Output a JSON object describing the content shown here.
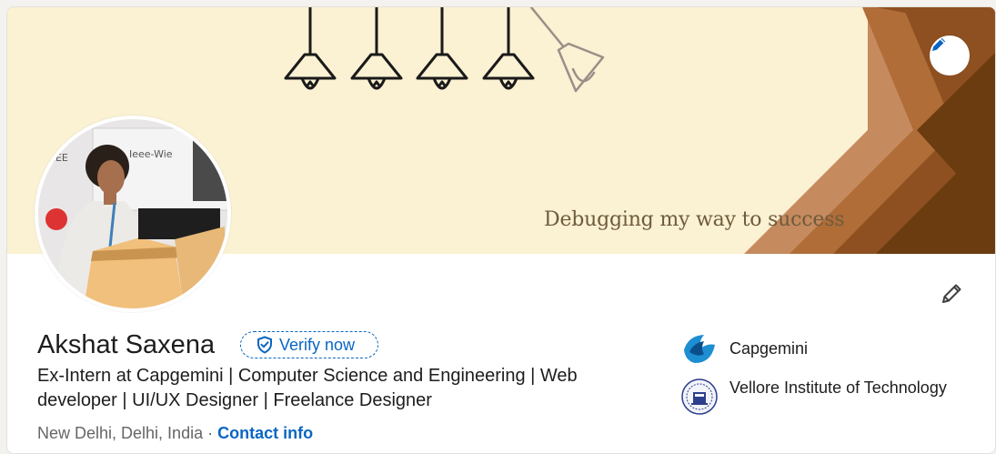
{
  "banner": {
    "tagline": "Debugging my way to success",
    "colors": {
      "background": "#fbf1d3",
      "chevron_light": "#c58a5e",
      "chevron_mid": "#a8652f",
      "chevron_dark": "#6a3c0f"
    }
  },
  "profile": {
    "name": "Akshat Saxena",
    "verify_label": "Verify now",
    "headline": "Ex-Intern at Capgemini | Computer Science and Engineering | Web developer | UI/UX Designer | Freelance Designer",
    "location": "New Delhi, Delhi, India",
    "separator": "·",
    "contact_label": "Contact info"
  },
  "organizations": [
    {
      "name": "Capgemini",
      "icon": "capgemini-logo"
    },
    {
      "name": "Vellore Institute of Technology",
      "icon": "vit-logo"
    }
  ],
  "icons": {
    "banner_edit": "pencil-icon",
    "profile_edit": "pencil-icon",
    "verify": "shield-check-icon"
  },
  "accent_color": "#0a66c2"
}
